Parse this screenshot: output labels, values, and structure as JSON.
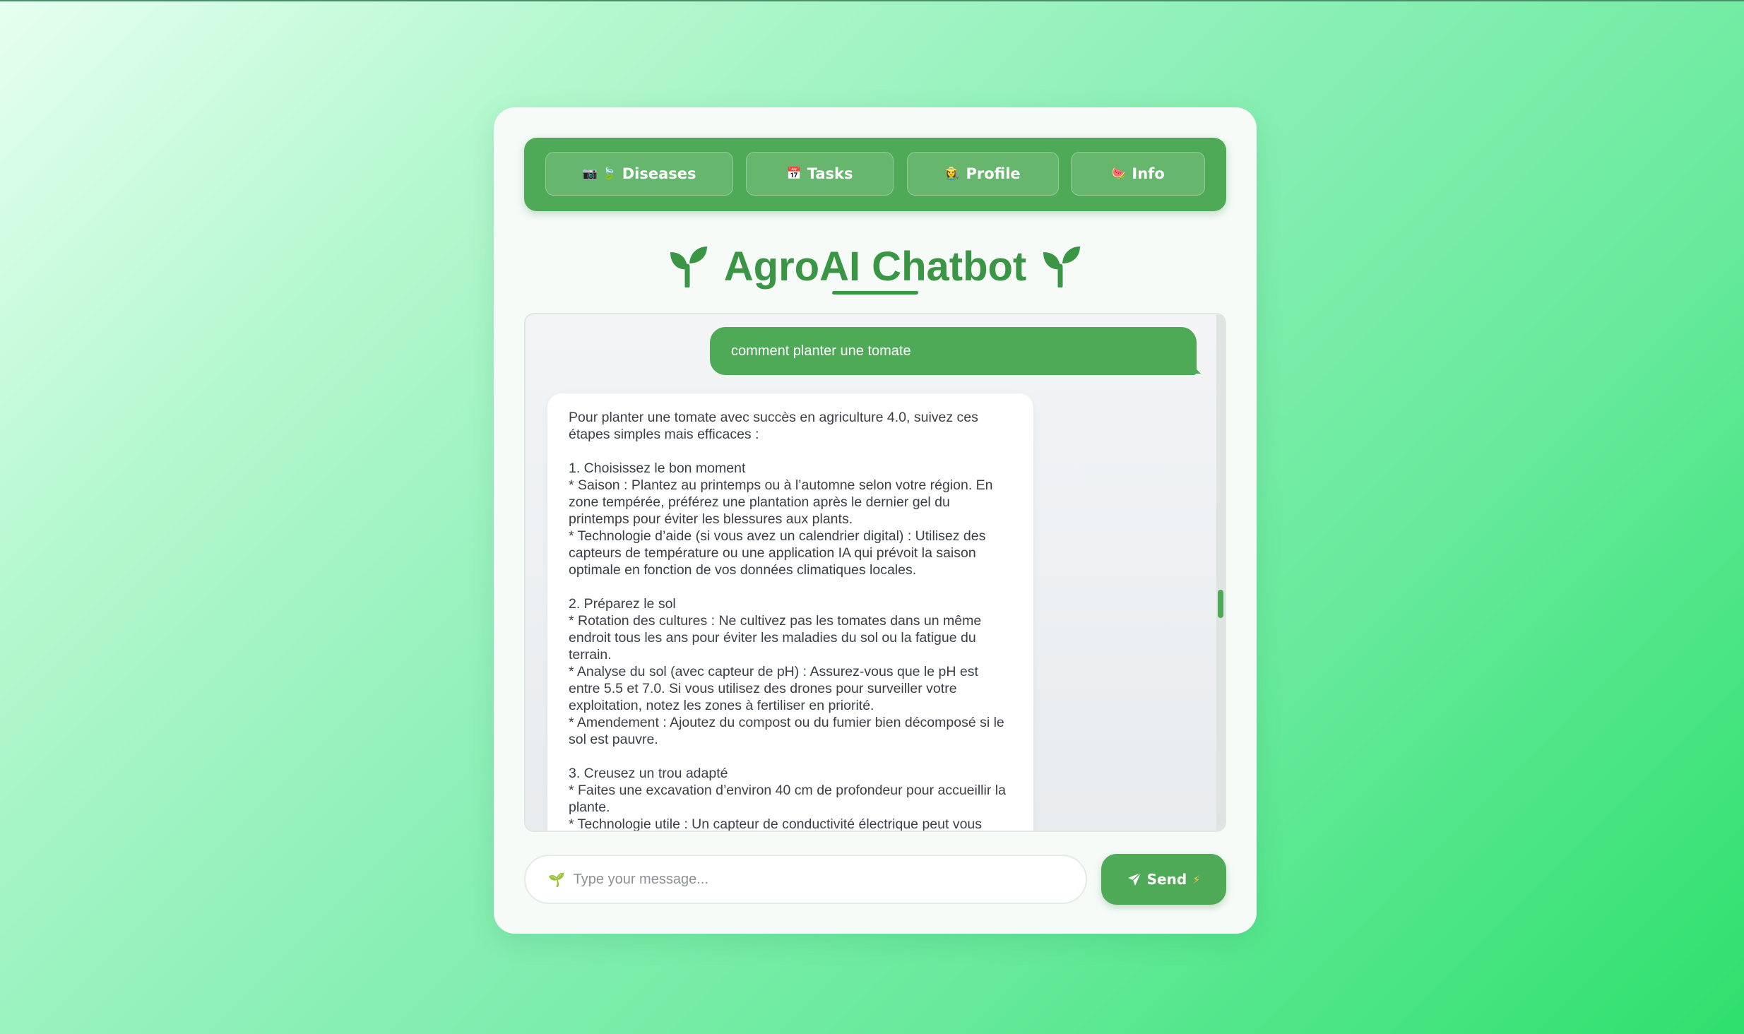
{
  "nav": {
    "items": [
      {
        "label": "Diseases",
        "icons": "📷 🍃"
      },
      {
        "label": "Tasks",
        "icons": "📅"
      },
      {
        "label": "Profile",
        "icons": "👩‍🌾"
      },
      {
        "label": "Info",
        "icons": "🍉"
      }
    ]
  },
  "header": {
    "title": "AgroAI Chatbot",
    "accent_color": "#3a9545"
  },
  "chat": {
    "user_message": "comment planter une tomate",
    "bot_message": "Pour planter une tomate avec succès en agriculture 4.0, suivez ces étapes simples mais efficaces :\n\n1. Choisissez le bon moment\n* Saison : Plantez au printemps ou à l’automne selon votre région. En zone tempérée, préférez une plantation après le dernier gel du printemps pour éviter les blessures aux plants.\n* Technologie d’aide (si vous avez un calendrier digital) : Utilisez des capteurs de température ou une application IA qui prévoit la saison optimale en fonction de vos données climatiques locales.\n\n2. Préparez le sol\n* Rotation des cultures : Ne cultivez pas les tomates dans un même endroit tous les ans pour éviter les maladies du sol ou la fatigue du terrain.\n* Analyse du sol (avec capteur de pH) : Assurez-vous que le pH est entre 5.5 et 7.0. Si vous utilisez des drones pour surveiller votre exploitation, notez les zones à fertiliser en priorité.\n* Amendement : Ajoutez du compost ou du fumier bien décomposé si le sol est pauvre.\n\n3. Creusez un trou adapté\n* Faites une excavation d’environ 40 cm de profondeur pour accueillir la plante.\n* Technologie utile : Un capteur de conductivité électrique peut vous",
    "user_bubble_color": "#4eaa57"
  },
  "composer": {
    "placeholder": "Type your message...",
    "send_label": "Send"
  }
}
